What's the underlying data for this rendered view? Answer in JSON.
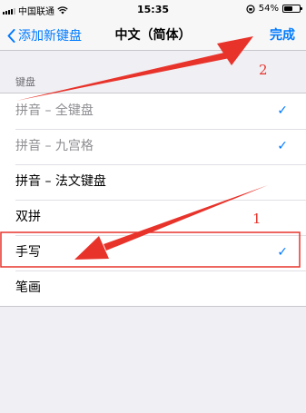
{
  "status_bar": {
    "carrier": "中国联通",
    "time": "15:35",
    "battery_text": "54%",
    "battery_level": 0.54
  },
  "nav": {
    "back_label": "添加新键盘",
    "title": "中文（简体）",
    "done_label": "完成"
  },
  "section_header": "键盘",
  "keyboards": [
    {
      "label": "拼音 – 全键盘",
      "checked": true,
      "disabled": true
    },
    {
      "label": "拼音 – 九宫格",
      "checked": true,
      "disabled": true
    },
    {
      "label": "拼音 – 法文键盘",
      "checked": false,
      "disabled": false
    },
    {
      "label": "双拼",
      "checked": false,
      "disabled": false
    },
    {
      "label": "手写",
      "checked": true,
      "disabled": false
    },
    {
      "label": "笔画",
      "checked": false,
      "disabled": false
    }
  ],
  "check_glyph": "✓",
  "annotations": {
    "label_1": "1",
    "label_2": "2",
    "color": "#e8332b"
  },
  "colors": {
    "accent": "#007aff",
    "background": "#efeff4"
  }
}
